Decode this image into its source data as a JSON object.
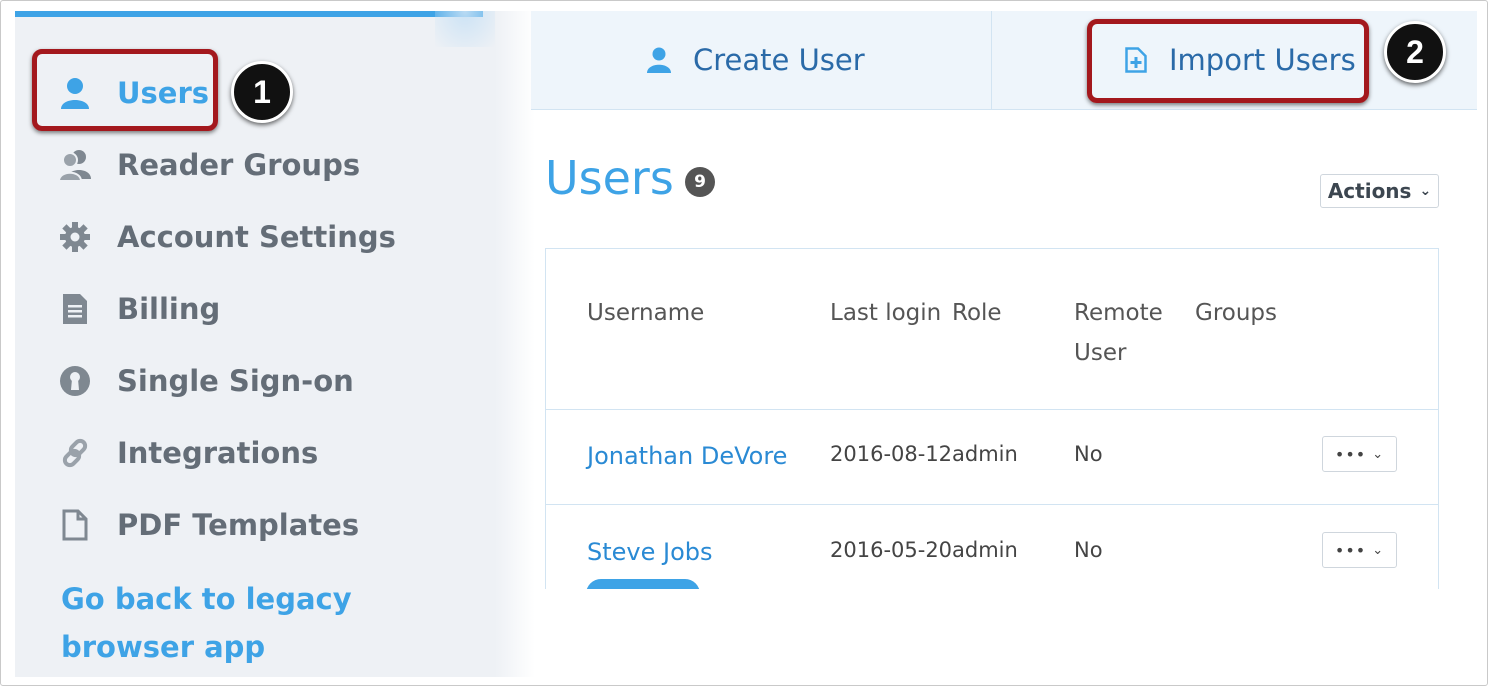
{
  "sidebar": {
    "items": [
      {
        "label": "Users",
        "icon": "user-icon",
        "active": true
      },
      {
        "label": "Reader Groups",
        "icon": "reader-groups-icon"
      },
      {
        "label": "Account Settings",
        "icon": "gear-icon"
      },
      {
        "label": "Billing",
        "icon": "document-icon"
      },
      {
        "label": "Single Sign-on",
        "icon": "keyhole-icon"
      },
      {
        "label": "Integrations",
        "icon": "link-icon"
      },
      {
        "label": "PDF Templates",
        "icon": "file-icon"
      }
    ],
    "legacy_link": "Go back to legacy browser app"
  },
  "topbar": {
    "create_user": "Create User",
    "import_users": "Import Users"
  },
  "callouts": {
    "one": "1",
    "two": "2"
  },
  "main": {
    "title": "Users",
    "count": "9",
    "actions_label": "Actions"
  },
  "table": {
    "headers": {
      "username": "Username",
      "last_login": "Last login",
      "role": "Role",
      "remote_user": "Remote User",
      "groups": "Groups"
    },
    "rows": [
      {
        "username": "Jonathan DeVore",
        "last_login": "2016-08-12",
        "role": "admin",
        "remote": "No",
        "groups": ""
      },
      {
        "username": "Steve Jobs",
        "last_login": "2016-05-20",
        "role": "admin",
        "remote": "No",
        "groups": ""
      }
    ],
    "row_menu_label": "•••"
  },
  "colors": {
    "accent": "#3ea3e6",
    "callout": "#a3181d",
    "link": "#2a8ad4"
  }
}
